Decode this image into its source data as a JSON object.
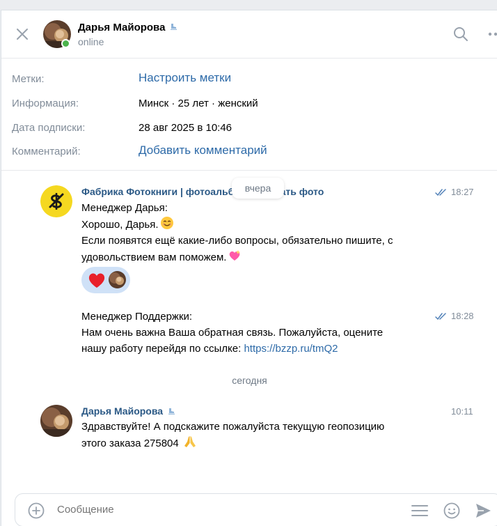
{
  "header": {
    "name": "Дарья Майорова",
    "status": "online"
  },
  "info": {
    "labels_label": "Метки:",
    "labels_action": "Настроить метки",
    "info_label": "Информация:",
    "info_value": "Минск · 25 лет · женский",
    "subscribed_label": "Дата подписки:",
    "subscribed_value": "28 авг 2025 в 10:46",
    "comment_label": "Комментарий:",
    "comment_action": "Добавить комментарий"
  },
  "messages": {
    "date_yesterday": "вчера",
    "date_today": "сегодня",
    "group": {
      "author": "Фабрика Фотокниги | фотоальбомы | печать фото",
      "msg1": {
        "time": "18:27",
        "lines": [
          "Менеджер Дарья:",
          "Хорошо, Дарья.",
          "Если появятся ещё какие-либо вопросы, обязательно пишите, с",
          "удовольствием вам поможем."
        ]
      },
      "msg2": {
        "time": "18:28",
        "lines": [
          "Менеджер Поддержки:",
          "Нам очень важна Ваша обратная связь. Пожалуйста, оцените",
          "нашу работу перейдя по ссылке: "
        ],
        "link": "https://bzzp.ru/tmQ2"
      }
    },
    "user": {
      "author": "Дарья Майорова",
      "time": "10:11",
      "lines": [
        "Здравствуйте! А подскажите пожалуйста текущую геопозицию",
        "этого заказа 275804"
      ]
    }
  },
  "composer": {
    "placeholder": "Сообщение"
  },
  "colors": {
    "accent": "#2d6aa8",
    "author": "#2a5885",
    "secondary": "#818c99",
    "online": "#4bb34b",
    "reaction_bg": "#cfe1f7"
  }
}
